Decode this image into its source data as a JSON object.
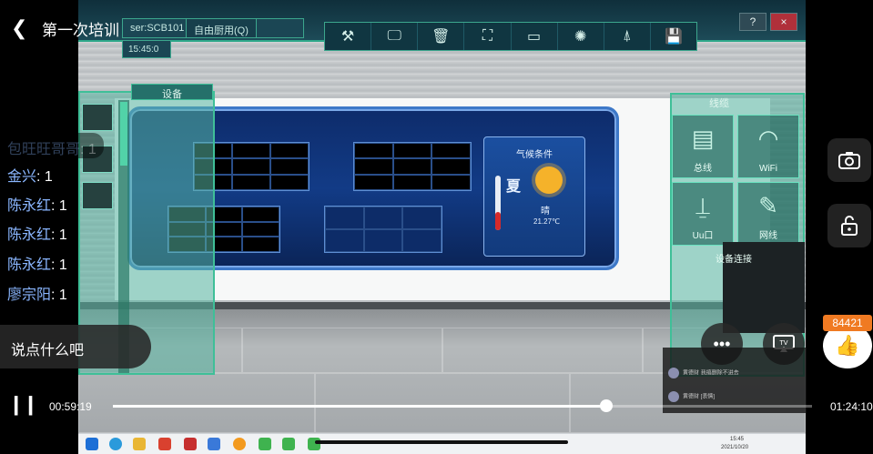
{
  "stream": {
    "title": "第一次培训",
    "likes": "84421",
    "time_current": "00:59:19",
    "time_total": "01:24:10",
    "progress": 0.706,
    "say_placeholder": "说点什么吧",
    "chat": [
      {
        "name": "包旺旺哥哥",
        "sep": ":",
        "msg": "1"
      },
      {
        "name": "金兴",
        "sep": ":",
        "msg": "1"
      },
      {
        "name": "陈永红",
        "sep": ":",
        "msg": "1"
      },
      {
        "name": "陈永红",
        "sep": ":",
        "msg": "1"
      },
      {
        "name": "陈永红",
        "sep": ":",
        "msg": "1"
      },
      {
        "name": "廖宗阳",
        "sep": ":",
        "msg": "1"
      }
    ],
    "comments": [
      {
        "name": "黄德财",
        "text": "我搞删除不进去"
      },
      {
        "name": "黄德财",
        "text": "[表情]"
      }
    ]
  },
  "app": {
    "user": "ser:SCB101",
    "mode": "自由厨用(Q)",
    "clock": "15:45:0",
    "help": "?",
    "close": "×",
    "device_panel_title": "设备",
    "cable_panel_title": "线缆",
    "cables": [
      {
        "label": "总线",
        "icon": "bus-icon"
      },
      {
        "label": "WiFi",
        "icon": "wifi-icon"
      },
      {
        "label": "Uu口",
        "icon": "antenna-icon"
      },
      {
        "label": "网线",
        "icon": "cable-icon"
      }
    ],
    "connect_label": "设备连接",
    "weather": {
      "title": "气候条件",
      "season": "夏",
      "condition": "晴",
      "temperature": "21.27℃"
    }
  },
  "taskbar": {
    "time": "15:45",
    "date": "2021/10/20"
  }
}
